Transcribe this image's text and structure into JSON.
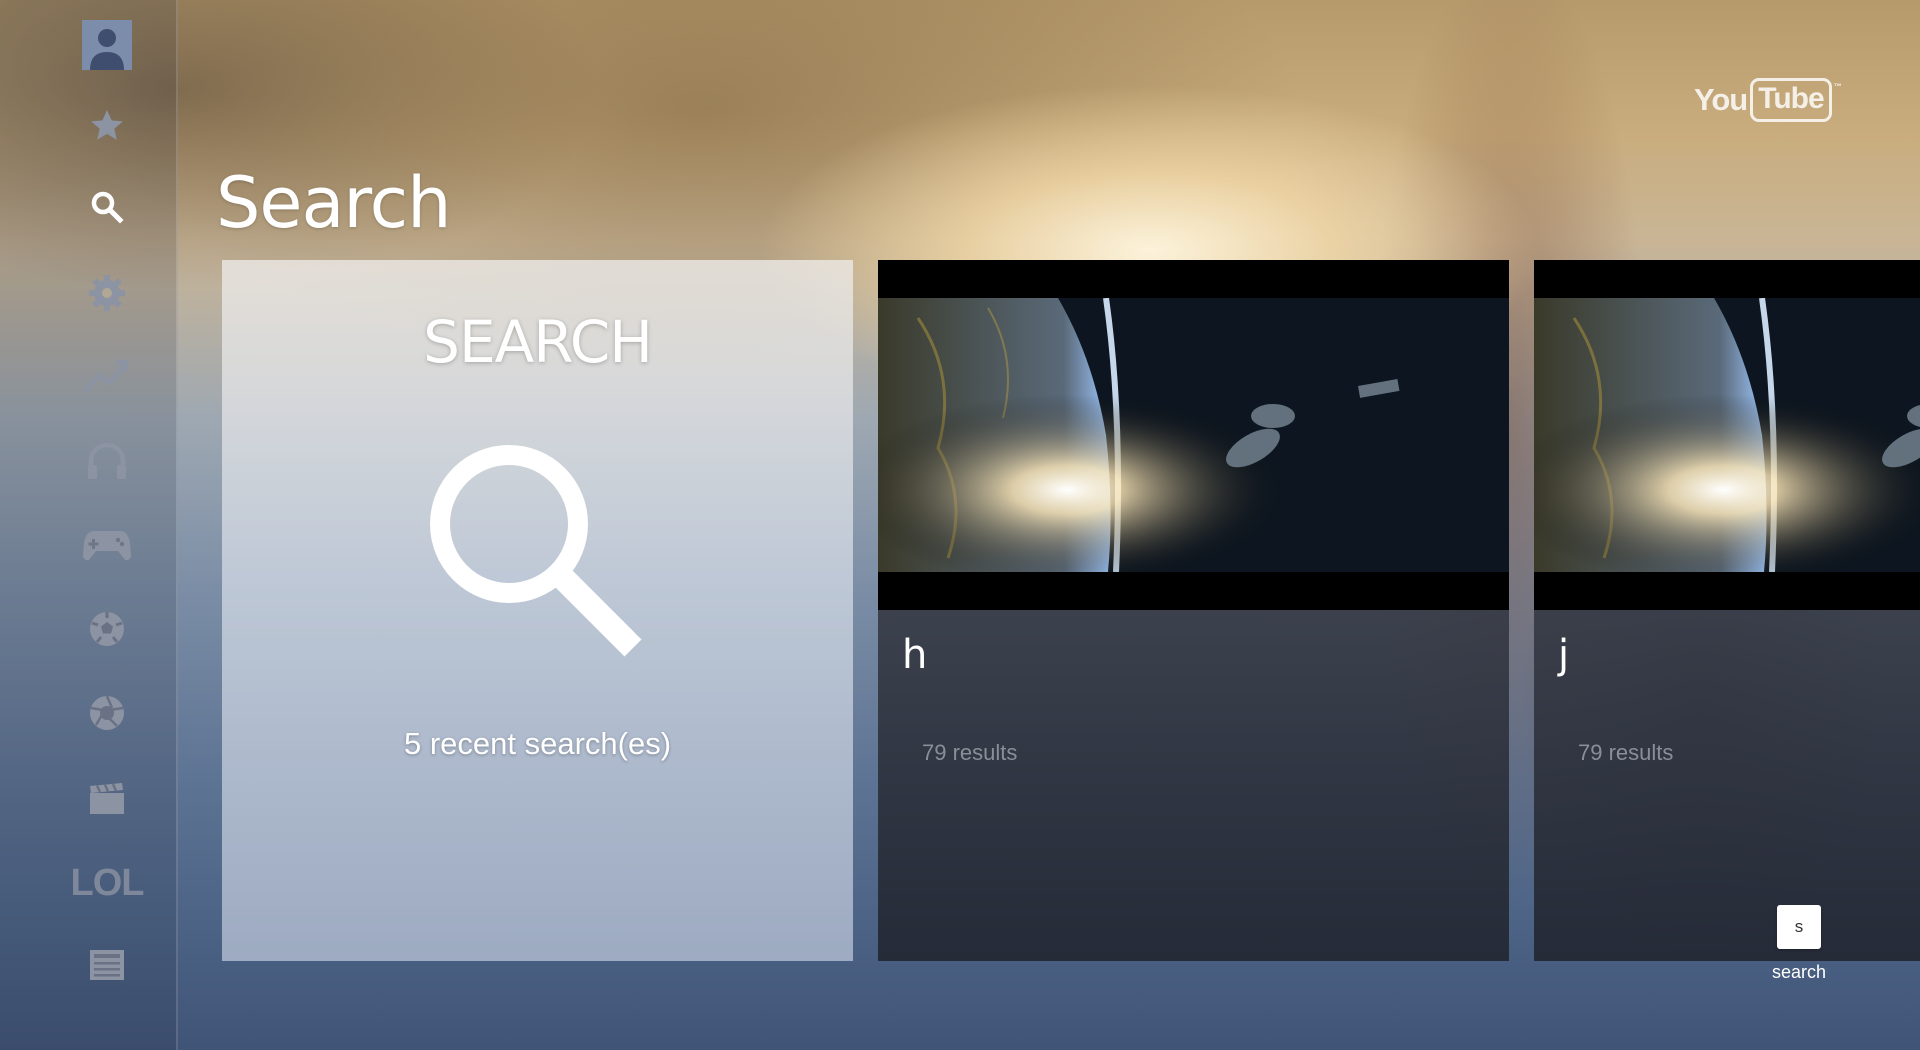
{
  "app": {
    "brand_you": "You",
    "brand_tube": "Tube",
    "brand_tm": "™"
  },
  "sidebar": {
    "items": [
      {
        "name": "account",
        "icon": "avatar-icon"
      },
      {
        "name": "favorites",
        "icon": "star-icon"
      },
      {
        "name": "search",
        "icon": "search-icon",
        "active": true
      },
      {
        "name": "settings",
        "icon": "gear-icon"
      },
      {
        "name": "trending",
        "icon": "trending-icon"
      },
      {
        "name": "music",
        "icon": "headphones-icon"
      },
      {
        "name": "gaming",
        "icon": "gamepad-icon"
      },
      {
        "name": "sports",
        "icon": "soccer-ball-icon"
      },
      {
        "name": "photography",
        "icon": "aperture-icon"
      },
      {
        "name": "movies",
        "icon": "clapperboard-icon"
      },
      {
        "name": "comedy",
        "icon": "lol-icon",
        "label": "LOL"
      },
      {
        "name": "news",
        "icon": "newspaper-icon"
      }
    ]
  },
  "header": {
    "title": "Search"
  },
  "search_card": {
    "heading": "SEARCH",
    "recent": "5 recent search(es)"
  },
  "results": [
    {
      "query": "h",
      "count": "79 results"
    },
    {
      "query": "j",
      "count": "79 results"
    }
  ],
  "key_hint": {
    "key": "s",
    "label": "search"
  },
  "colors": {
    "icon_inactive": "#8c93a3",
    "icon_active": "#ffffff",
    "card_light": "#dcdfe6",
    "card_dark": "#2a2e3a"
  }
}
